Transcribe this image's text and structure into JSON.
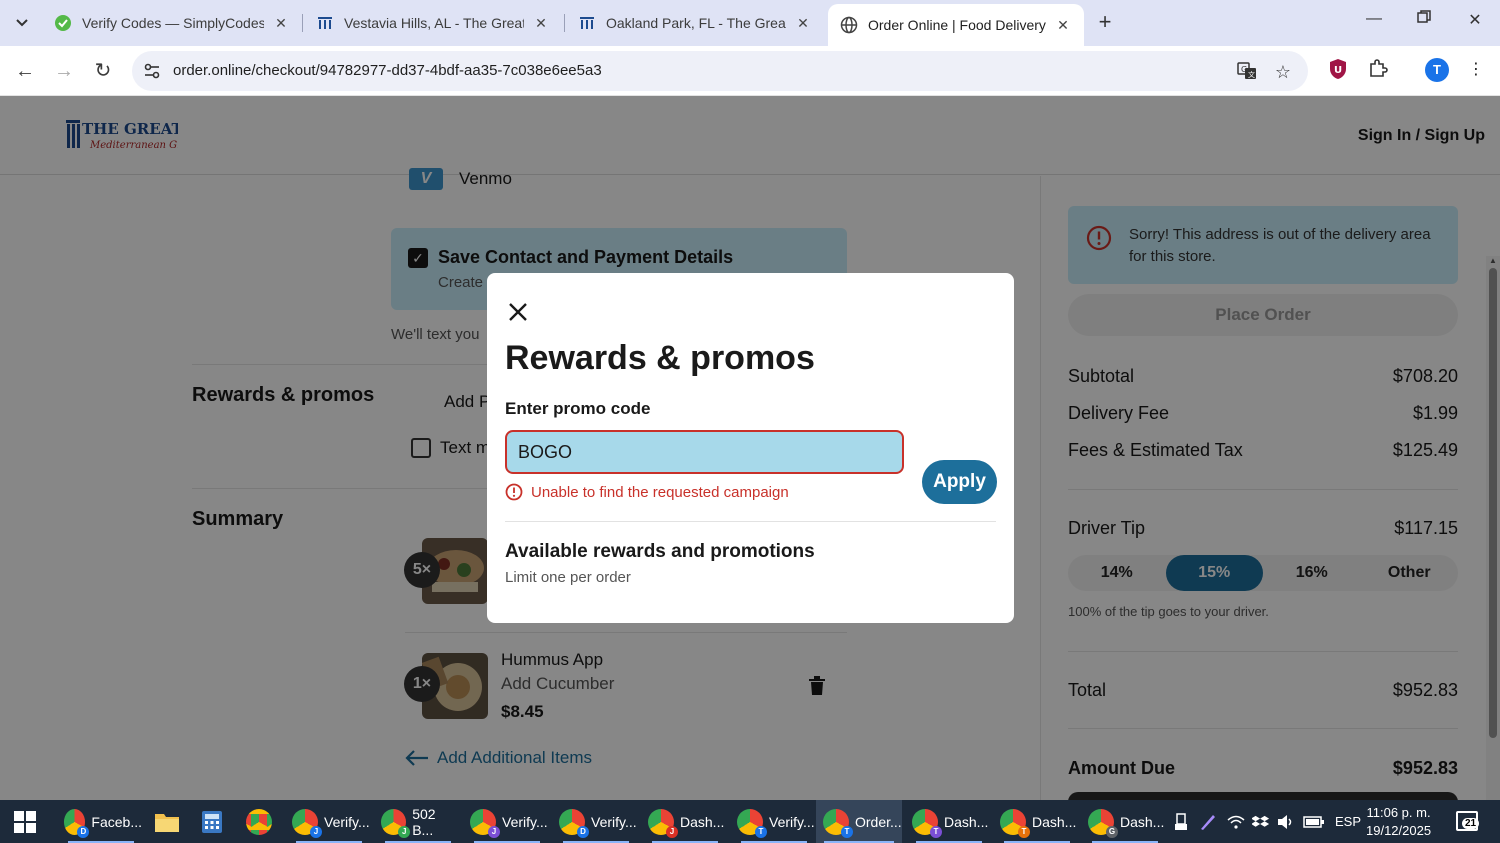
{
  "browser": {
    "tabs": [
      {
        "title": "Verify Codes — SimplyCodes",
        "active": false
      },
      {
        "title": "Vestavia Hills, AL - The Great Gr",
        "active": false
      },
      {
        "title": "Oakland Park, FL - The Great Gr",
        "active": false
      },
      {
        "title": "Order Online | Food Delivery &",
        "active": true
      }
    ],
    "url": "order.online/checkout/94782977-dd37-4bdf-aa35-7c038e6ee5a3"
  },
  "header": {
    "logo_text_1": "THE GREAT GREEK",
    "logo_text_2": "Mediterranean Grill",
    "signin": "Sign In / Sign Up"
  },
  "checkout": {
    "venmo_label": "Venmo",
    "save_title": "Save Contact and Payment Details",
    "save_sub": "Create",
    "text_you": "We'll text you",
    "rewards_title": "Rewards & promos",
    "add_promo": "Add P",
    "text_me": "Text m",
    "summary_title": "Summary",
    "items": [
      {
        "qty": "5×"
      },
      {
        "qty": "1×",
        "name": "Hummus App",
        "modifier": "Add Cucumber",
        "price": "$8.45"
      }
    ],
    "add_items": "Add Additional Items"
  },
  "order_panel": {
    "alert": "Sorry! This address is out of the delivery area for this store.",
    "place_order": "Place Order",
    "subtotal_label": "Subtotal",
    "subtotal": "$708.20",
    "delivery_label": "Delivery Fee",
    "delivery": "$1.99",
    "fees_label": "Fees & Estimated Tax",
    "fees": "$125.49",
    "tip_label": "Driver Tip",
    "tip": "$117.15",
    "tip_options": [
      "14%",
      "15%",
      "16%",
      "Other"
    ],
    "tip_selected": "15%",
    "tip_note": "100% of the tip goes to your driver.",
    "total_label": "Total",
    "total": "$952.83",
    "due_label": "Amount Due",
    "due": "$952.83"
  },
  "modal": {
    "title": "Rewards & promos",
    "promo_label": "Enter promo code",
    "promo_value": "BOGO",
    "error": "Unable to find the requested campaign",
    "apply": "Apply",
    "available_title": "Available rewards and promotions",
    "available_sub": "Limit one per order"
  },
  "taskbar": {
    "items": [
      {
        "label": "Faceb...",
        "badge": "D",
        "badge_color": "#1a73e8"
      },
      {
        "label": "Verify...",
        "badge": "J",
        "badge_color": "#1a73e8"
      },
      {
        "label": "502 B...",
        "badge": "J",
        "badge_color": "#34a853"
      },
      {
        "label": "Verify...",
        "badge": "J",
        "badge_color": "#7b4fd6"
      },
      {
        "label": "Verify...",
        "badge": "D",
        "badge_color": "#1a73e8"
      },
      {
        "label": "Dash...",
        "badge": "J",
        "badge_color": "#d93025"
      },
      {
        "label": "Verify...",
        "badge": "T",
        "badge_color": "#1a73e8"
      },
      {
        "label": "Order...",
        "badge": "T",
        "badge_color": "#1a73e8"
      },
      {
        "label": "Dash...",
        "badge": "T",
        "badge_color": "#7b4fd6"
      },
      {
        "label": "Dash...",
        "badge": "T",
        "badge_color": "#e8710a"
      },
      {
        "label": "Dash...",
        "badge": "G",
        "badge_color": "#5f6368"
      }
    ],
    "lang": "ESP",
    "time": "11:06 p. m.",
    "date": "19/12/2025",
    "notifications": "21"
  }
}
